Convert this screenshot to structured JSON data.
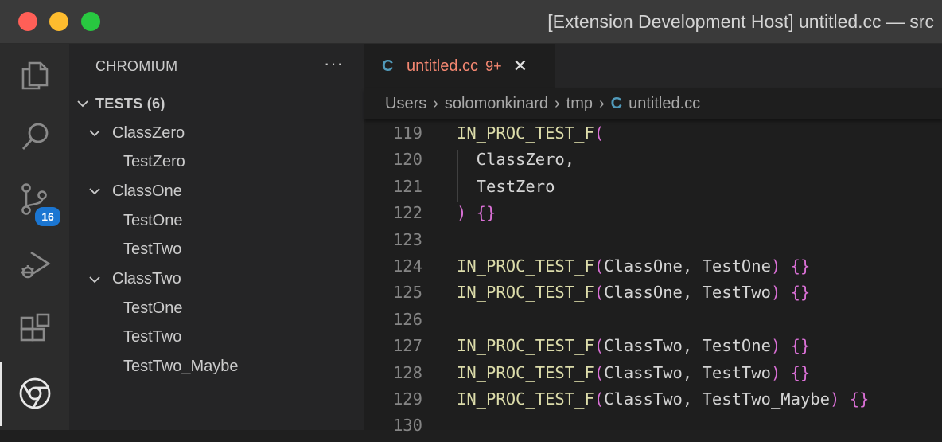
{
  "window": {
    "title": "[Extension Development Host] untitled.cc — src"
  },
  "activity_bar": {
    "items": [
      "explorer-icon",
      "search-icon",
      "source-control-icon",
      "run-debug-icon",
      "extensions-icon",
      "chromium-icon"
    ],
    "source_control_badge": "16",
    "active_item": "chromium-icon"
  },
  "sidebar": {
    "title": "CHROMIUM",
    "more_actions": "···",
    "section": {
      "label": "TESTS (6)"
    },
    "tree": [
      {
        "label": "ClassZero",
        "level": 1
      },
      {
        "label": "TestZero",
        "level": 2
      },
      {
        "label": "ClassOne",
        "level": 1
      },
      {
        "label": "TestOne",
        "level": 2
      },
      {
        "label": "TestTwo",
        "level": 2
      },
      {
        "label": "ClassTwo",
        "level": 1
      },
      {
        "label": "TestOne",
        "level": 2
      },
      {
        "label": "TestTwo",
        "level": 2
      },
      {
        "label": "TestTwo_Maybe",
        "level": 2
      }
    ]
  },
  "editor": {
    "tab": {
      "icon": "C",
      "label": "untitled.cc",
      "problems": "9+",
      "close": "✕"
    },
    "breadcrumb": [
      "Users",
      "solomonkinard",
      "tmp",
      "untitled.cc"
    ],
    "breadcrumb_icon": "C",
    "lines": [
      {
        "num": "119",
        "fn": "IN_PROC_TEST_F",
        "open": "(",
        "args": "",
        "close": "",
        "body": ""
      },
      {
        "num": "120",
        "fn": "",
        "open": "",
        "args": "  ClassZero,",
        "close": "",
        "body": ""
      },
      {
        "num": "121",
        "fn": "",
        "open": "",
        "args": "  TestZero",
        "close": "",
        "body": ""
      },
      {
        "num": "122",
        "fn": "",
        "open": "",
        "args": "",
        "close": ")",
        "body": " {}"
      },
      {
        "num": "123",
        "fn": "",
        "open": "",
        "args": "",
        "close": "",
        "body": ""
      },
      {
        "num": "124",
        "fn": "IN_PROC_TEST_F",
        "open": "(",
        "args": "ClassOne, TestOne",
        "close": ")",
        "body": " {}"
      },
      {
        "num": "125",
        "fn": "IN_PROC_TEST_F",
        "open": "(",
        "args": "ClassOne, TestTwo",
        "close": ")",
        "body": " {}"
      },
      {
        "num": "126",
        "fn": "",
        "open": "",
        "args": "",
        "close": "",
        "body": ""
      },
      {
        "num": "127",
        "fn": "IN_PROC_TEST_F",
        "open": "(",
        "args": "ClassTwo, TestOne",
        "close": ")",
        "body": " {}"
      },
      {
        "num": "128",
        "fn": "IN_PROC_TEST_F",
        "open": "(",
        "args": "ClassTwo, TestTwo",
        "close": ")",
        "body": " {}"
      },
      {
        "num": "129",
        "fn": "IN_PROC_TEST_F",
        "open": "(",
        "args": "ClassTwo, TestTwo_Maybe",
        "close": ")",
        "body": " {}"
      },
      {
        "num": "130",
        "fn": "",
        "open": "",
        "args": "",
        "close": "",
        "body": ""
      }
    ]
  },
  "colors": {
    "function": "#dcdcaa",
    "punctuation": "#da70d6",
    "identifier": "#d4d4d4",
    "modified_tab": "#f48771",
    "badge": "#1b76d2"
  }
}
